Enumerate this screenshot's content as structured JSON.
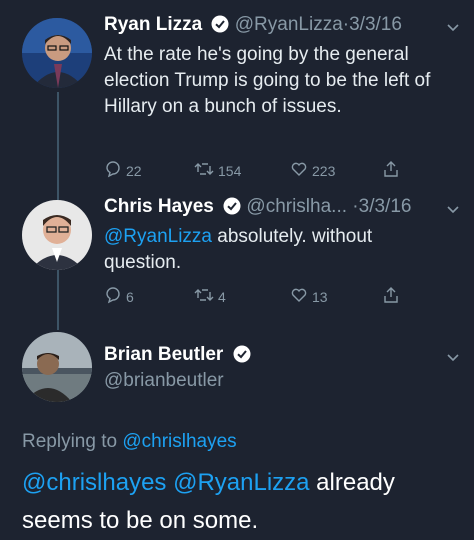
{
  "colors": {
    "background": "#1d2330",
    "link": "#1da1f2",
    "muted": "#8899a6",
    "text": "#e6ecf0"
  },
  "tweets": [
    {
      "name": "Ryan Lizza",
      "handle": "@RyanLizza",
      "separator": "·",
      "date": "3/3/16",
      "text": "At the rate he's going by the general election Trump is going to be the left of Hillary on a bunch of issues.",
      "replies": "22",
      "retweets": "154",
      "likes": "223"
    },
    {
      "name": "Chris Hayes",
      "handle": "@chrislha...",
      "separator": "·",
      "date": "3/3/16",
      "mention": "@RyanLizza",
      "text": " absolutely. without question.",
      "replies": "6",
      "retweets": "4",
      "likes": "13"
    },
    {
      "name": "Brian Beutler",
      "handle": "@brianbeutler"
    }
  ],
  "reply_context": {
    "prefix": "Replying to ",
    "mention": "@chrislhayes"
  },
  "main_tweet": {
    "mention1": "@chrislhayes",
    "mention2": "@RyanLizza",
    "text_a": " already",
    "text_b": "seems to be on some."
  }
}
